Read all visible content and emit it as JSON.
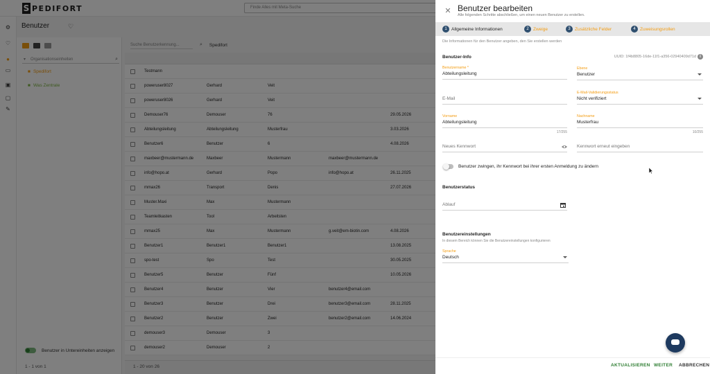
{
  "app": {
    "logo_text": "PEDIFORT",
    "logo_mark": "S",
    "global_search_placeholder": "Finde Alles mit Meta-Suche",
    "page_title": "Benutzer",
    "rail_icons": [
      "settings-icon",
      "heart-icon",
      "users-icon",
      "id-card-icon",
      "image-icon",
      "monitor-icon",
      "wrench-icon"
    ]
  },
  "left_panel": {
    "filter_placeholder": "Organisationseinheiten",
    "tree": [
      {
        "label": "Spedifort",
        "color": "#f39c12"
      },
      {
        "label": "Was Zentrale",
        "color": "#7cb342"
      }
    ],
    "toggle_label": "Benutzer in Untereinheiten anzeigen",
    "count_text": "1 - 1 von 1"
  },
  "grid": {
    "search_placeholder": "Suche Benutzerkennung...",
    "view_label": "Spedifort",
    "rows": [
      [
        "Testmann",
        "",
        "",
        "",
        ""
      ],
      [
        "poweruser8027",
        "Gerhard",
        "Veit",
        "",
        ""
      ],
      [
        "poweruser8026",
        "Gerhard",
        "Veit",
        "",
        ""
      ],
      [
        "Demouser76",
        "Demouser",
        "76",
        "",
        "29.05.2026"
      ],
      [
        "Abteilungsleitung",
        "Abteilungsleitung",
        "Musterfrau",
        "",
        "3.03.2026"
      ],
      [
        "Benutzer6",
        "Benutzer",
        "6",
        "",
        "4.08.2026"
      ],
      [
        "maxbeer@mustermann.de",
        "Maxbeer",
        "Mustermann",
        "maxbeer@mustermann.de",
        ""
      ],
      [
        "info@hopo.at",
        "Gerhard",
        "Popo",
        "info@hopo.at",
        "26.11.2025"
      ],
      [
        "mmax26",
        "Transport",
        "Denis",
        "",
        "27.07.2026"
      ],
      [
        "Muster.Maxi",
        "Max",
        "Mustermann",
        "",
        ""
      ],
      [
        "Teamleitkasten",
        "Tool",
        "Arbeitsten",
        "",
        ""
      ],
      [
        "mmax25",
        "Max",
        "Mustermann",
        "g.veit@em-biotin.com",
        "4.08.2026"
      ],
      [
        "Benutzer1",
        "Benutzer1",
        "Benutzer1",
        "",
        "13.08.2025"
      ],
      [
        "spo-test",
        "Spo",
        "Test",
        "",
        "30.05.2025"
      ],
      [
        "Benutzer5",
        "Benutzer",
        "Fünf",
        "",
        "10.05.2026"
      ],
      [
        "Benutzer4",
        "Benutzer",
        "Vier",
        "benutzer4@email.com",
        ""
      ],
      [
        "Benutzer3",
        "Benutzer",
        "Drei",
        "benutzer3@email.com",
        "28.11.2025"
      ],
      [
        "Benutzer2",
        "Benutzer",
        "Zwei",
        "benutzer2@email.com",
        "14.06.2024"
      ],
      [
        "demouser3",
        "Demouser",
        "3",
        "",
        ""
      ],
      [
        "demouser2",
        "Demouser",
        "2",
        "",
        ""
      ]
    ],
    "footer_text": "1 - 20 von 26"
  },
  "drawer": {
    "title": "Benutzer bearbeiten",
    "subtitle": "Alle folgenden Schritte abschließen, um einen neuen Benutzer zu erstellen.",
    "steps": [
      {
        "num": "1",
        "label": "Allgemeine Informationen",
        "active": true
      },
      {
        "num": "2",
        "label": "Zweige",
        "active": false
      },
      {
        "num": "3",
        "label": "Zusätzliche Felder",
        "active": false
      },
      {
        "num": "4",
        "label": "Zuweisungsrollen",
        "active": false
      }
    ],
    "step_info": "Die Informationen für den Benutzer angeben, den Sie erstellen werden",
    "user_info_title": "Benutzer-Info",
    "uuid_text": "UUID: 1f4b8805-16de-11f1-a356-02940409d71d",
    "fields": {
      "username": {
        "label": "Benutzername *",
        "value": "Abteilungsleitung"
      },
      "level": {
        "label": "Ebene",
        "value": "Benutzer"
      },
      "email": {
        "label": "",
        "placeholder": "E-Mail"
      },
      "email_verify": {
        "label": "E-Mail-Validierungsstatus",
        "value": "Nicht verifiziert"
      },
      "firstname": {
        "label": "Vorname",
        "value": "Abteilungsleitung",
        "counter": "17/255"
      },
      "lastname": {
        "label": "Nachname",
        "value": "Musterfrau",
        "counter": "10/255"
      },
      "password": {
        "placeholder": "Neues Kennwort"
      },
      "password_repeat": {
        "placeholder": "Kennwort erneut eingeben"
      },
      "expiry": {
        "placeholder": "Ablauf"
      },
      "language": {
        "label": "Sprache",
        "value": "Deutsch"
      }
    },
    "force_pw_label": "Benutzer zwingen, ihr Kennwort bei ihrer ersten Anmeldung zu ändern",
    "status_title": "Benutzerstatus",
    "settings_title": "Benutzereinstellungen",
    "settings_sub": "In diesem Bereich können Sie die Benutzereinstellungen konfigurieren",
    "buttons": {
      "update": "AKTUALISIEREN",
      "next": "WEITER",
      "cancel": "ABBRECHEN"
    },
    "colors": {
      "accent": "#f39c12",
      "step_circle": "#2f4f6f",
      "action_green": "#2e7d32",
      "chat": "#1e3a5f"
    }
  }
}
